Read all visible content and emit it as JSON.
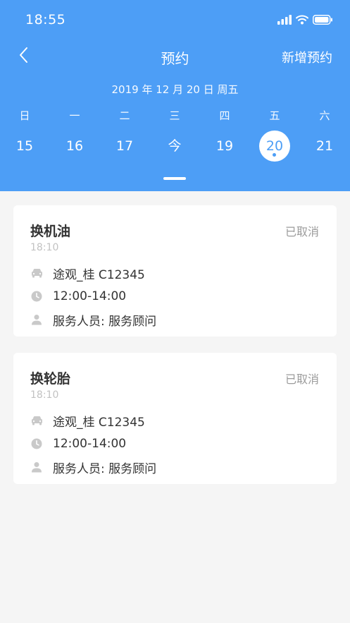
{
  "status_bar": {
    "time": "18:55"
  },
  "nav": {
    "title": "预约",
    "action_label": "新增预约"
  },
  "calendar": {
    "date_line": "2019 年 12 月 20 日 周五",
    "weekdays": [
      "日",
      "一",
      "二",
      "三",
      "四",
      "五",
      "六"
    ],
    "days": [
      "15",
      "16",
      "17",
      "今",
      "19",
      "20",
      "21"
    ],
    "selected_day": "20"
  },
  "appointments": [
    {
      "title": "换机油",
      "status": "已取消",
      "time": "18:10",
      "vehicle": "途观_桂 C12345",
      "slot": "12:00-14:00",
      "staff": "服务人员: 服务顾问"
    },
    {
      "title": "换轮胎",
      "status": "已取消",
      "time": "18:10",
      "vehicle": "途观_桂 C12345",
      "slot": "12:00-14:00",
      "staff": "服务人员: 服务顾问"
    }
  ],
  "colors": {
    "primary": "#4d9ef6",
    "text_dark": "#333333",
    "text_muted": "#9b9b9b",
    "text_light": "#c2c2c2",
    "background": "#f5f5f5"
  },
  "icons": {
    "back": "chevron-left-icon",
    "signal": "signal-icon",
    "wifi": "wifi-icon",
    "battery": "battery-icon",
    "vehicle": "car-icon",
    "time": "clock-icon",
    "staff": "person-icon"
  }
}
